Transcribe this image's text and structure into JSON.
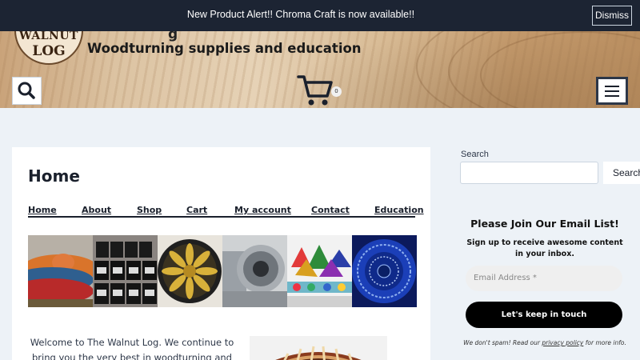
{
  "announcement": {
    "text": "New Product Alert!! Chroma Craft is now available!!",
    "dismiss_label": "Dismiss"
  },
  "header": {
    "logo_line1": "WALNUT",
    "logo_line2": "LOG",
    "title_partial": "g",
    "tagline": "Woodturning supplies and education",
    "cart_count": "0"
  },
  "page": {
    "title": "Home",
    "nav": [
      "Home",
      "About",
      "Shop",
      "Cart",
      "My account",
      "Contact",
      "Education"
    ],
    "welcome_text": "Welcome to The Walnut Log. We continue to bring you the very best in woodturning and"
  },
  "sidebar": {
    "search_label": "Search",
    "search_button": "Search",
    "email_heading": "Please Join Our Email List!",
    "email_sub": "Sign up to receive awesome content in your inbox.",
    "email_placeholder": "Email Address *",
    "email_button": "Let's keep in touch",
    "fine_print_before": "We don't spam! Read our ",
    "fine_print_link": "privacy policy",
    "fine_print_after": " for more info."
  },
  "colors": {
    "announcement_bg": "#1c2433",
    "page_bg": "#edf2f7",
    "button_dark": "#000000"
  }
}
